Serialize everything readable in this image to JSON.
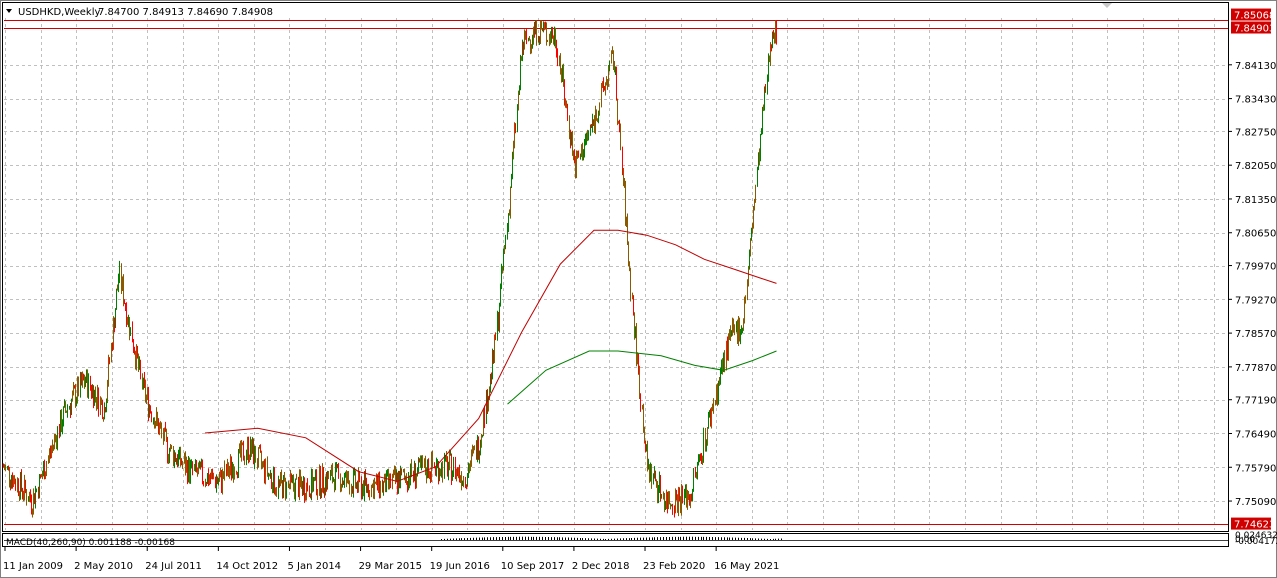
{
  "window": {
    "title": "USDHKD,Weekly",
    "ohlc": "7.84700 7.84913 7.84690 7.84908"
  },
  "price_axis": {
    "ticks": [
      "7.84130",
      "7.83430",
      "7.82750",
      "7.82050",
      "7.81350",
      "7.80650",
      "7.79970",
      "7.79270",
      "7.78570",
      "7.77870",
      "7.77190",
      "7.76490",
      "7.75790",
      "7.75090"
    ],
    "tags": {
      "top_line": "7.85068",
      "last_price": "7.84903",
      "bottom_line": "7.74623"
    }
  },
  "time_axis": {
    "ticks": [
      "11 Jan 2009",
      "2 May 2010",
      "24 Jul 2011",
      "14 Oct 2012",
      "5 Jan 2014",
      "29 Mar 2015",
      "19 Jun 2016",
      "10 Sep 2017",
      "2 Dec 2018",
      "23 Feb 2020",
      "16 May 2021"
    ]
  },
  "macd": {
    "label": "MACD(40,260,90) 0.001188 -0.00168",
    "ticks": [
      "0.024632",
      "0.00",
      "-0.004172"
    ]
  },
  "colors": {
    "up_candle": "#008000",
    "down_candle": "#ff0000",
    "mixed_candle": "#8b5a00",
    "ma_red": "#c00000",
    "ma_green": "#008000",
    "grid": "#c0c0c0",
    "level_line": "#d00000"
  },
  "chart_data": {
    "type": "line",
    "symbol": "USDHKD",
    "timeframe": "Weekly",
    "ylim": [
      7.7449,
      7.851
    ],
    "x_ticks": [
      "11 Jan 2009",
      "2 May 2010",
      "24 Jul 2011",
      "14 Oct 2012",
      "5 Jan 2014",
      "29 Mar 2015",
      "19 Jun 2016",
      "10 Sep 2017",
      "2 Dec 2018",
      "23 Feb 2020",
      "16 May 2021"
    ],
    "horizontal_levels": [
      7.85068,
      7.74623
    ],
    "last_price": 7.84903,
    "series": [
      {
        "x": [
          "2009-01",
          "2009-07",
          "2010-02",
          "2010-06",
          "2010-10",
          "2011-01",
          "2011-06",
          "2011-11",
          "2012-04",
          "2012-10",
          "2013-04",
          "2013-10",
          "2014-04",
          "2014-10",
          "2015-03",
          "2015-08",
          "2016-01",
          "2016-06",
          "2016-10",
          "2017-01",
          "2017-04",
          "2017-07",
          "2017-10",
          "2018-01",
          "2018-04",
          "2018-08",
          "2018-12",
          "2019-04",
          "2019-08",
          "2019-12",
          "2020-03",
          "2020-07",
          "2020-12",
          "2021-04",
          "2021-08",
          "2021-11",
          "2022-02",
          "2022-05",
          "2022-06"
        ],
        "values": [
          7.758,
          7.751,
          7.77,
          7.776,
          7.77,
          7.798,
          7.774,
          7.762,
          7.757,
          7.755,
          7.762,
          7.754,
          7.754,
          7.756,
          7.754,
          7.754,
          7.756,
          7.758,
          7.758,
          7.756,
          7.763,
          7.78,
          7.81,
          7.845,
          7.849,
          7.847,
          7.82,
          7.83,
          7.843,
          7.79,
          7.758,
          7.751,
          7.752,
          7.768,
          7.784,
          7.788,
          7.82,
          7.849,
          7.849
        ]
      },
      {
        "x": [
          "2012-07",
          "2013-06",
          "2014-04",
          "2015-03",
          "2015-11",
          "2016-07",
          "2017-04",
          "2018-01",
          "2018-09",
          "2019-04",
          "2019-09",
          "2020-03",
          "2020-09",
          "2021-03",
          "2021-09",
          "2022-03",
          "2022-06"
        ],
        "values": [
          7.765,
          7.766,
          7.764,
          7.757,
          7.755,
          7.758,
          7.768,
          7.786,
          7.8,
          7.807,
          7.807,
          7.806,
          7.804,
          7.801,
          7.799,
          7.797,
          7.796
        ]
      },
      {
        "x": [
          "2017-10",
          "2018-06",
          "2019-03",
          "2019-09",
          "2020-06",
          "2021-01",
          "2021-07",
          "2022-01",
          "2022-06"
        ],
        "values": [
          7.771,
          7.778,
          7.782,
          7.782,
          7.781,
          7.779,
          7.778,
          7.78,
          7.782
        ]
      }
    ]
  }
}
